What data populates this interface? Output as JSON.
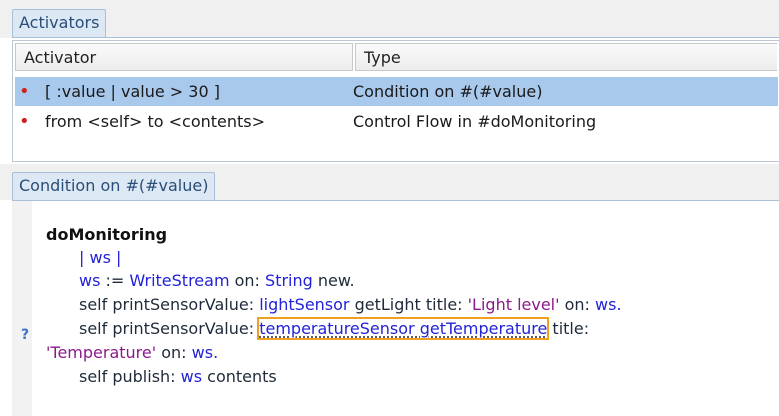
{
  "activators_tab": "Activators",
  "columns": {
    "activator": "Activator",
    "type": "Type"
  },
  "rows": [
    {
      "activator": "[ :value | value > 30 ]",
      "type": "Condition on #(#value)"
    },
    {
      "activator": "from <self> to <contents>",
      "type": "Control Flow in #doMonitoring"
    }
  ],
  "detail_tab": "Condition on #(#value)",
  "gutter_marker": "?",
  "code": {
    "method": "doMonitoring",
    "l1": "| ws |",
    "l2": {
      "a": "ws",
      "b": " := ",
      "c": "WriteStream",
      "d": " on: ",
      "e": "String",
      "f": " new."
    },
    "l3": {
      "a": "self printSensorValue: ",
      "b": "lightSensor",
      "c": " getLight title: ",
      "d": "'Light level'",
      "e": " on: ",
      "f": "ws."
    },
    "l4": {
      "a": "self printSensorValue: ",
      "b": "temperatureSensor getTemperature",
      "c": " title:"
    },
    "l5": {
      "a": "'Temperature'",
      "b": " on: ",
      "c": "ws."
    },
    "l6": {
      "a": "self publish: ",
      "b": "ws",
      "c": " contents"
    }
  }
}
